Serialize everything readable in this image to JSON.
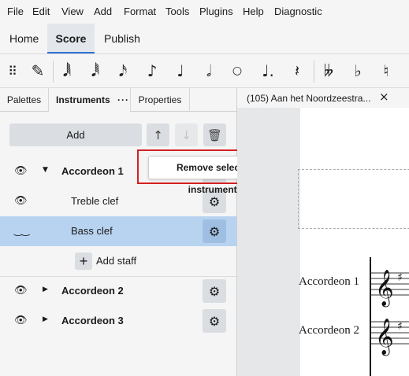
{
  "menu": [
    "File",
    "Edit",
    "View",
    "Add",
    "Format",
    "Tools",
    "Plugins",
    "Help",
    "Diagnostic"
  ],
  "workspace_tabs": [
    {
      "label": "Home",
      "active": false
    },
    {
      "label": "Score",
      "active": true
    },
    {
      "label": "Publish",
      "active": false
    }
  ],
  "toolbar": {
    "icons": [
      "drag-handle-icon",
      "pencil-icon",
      "64th-note-icon",
      "32nd-note-icon",
      "16th-note-icon",
      "eighth-note-icon",
      "quarter-note-icon",
      "half-note-icon",
      "whole-note-icon",
      "augmentation-dot-icon",
      "quarter-rest-icon",
      "double-flat-icon",
      "flat-icon",
      "natural-icon"
    ]
  },
  "panel": {
    "tabs": [
      {
        "label": "Palettes"
      },
      {
        "label": "Instruments",
        "menu": "···",
        "active": true
      },
      {
        "label": "Properties"
      }
    ],
    "add_label": "Add",
    "tooltip": "Remove selected instruments",
    "rows": [
      {
        "label": "Accordeon 1",
        "bold": true,
        "expanded": true
      },
      {
        "label": "Treble clef",
        "bold": false
      },
      {
        "label": "Bass clef",
        "bold": false,
        "selected": true
      },
      {
        "label": "Add staff"
      },
      {
        "label": "Accordeon 2",
        "bold": true,
        "expanded": false
      },
      {
        "label": "Accordeon 3",
        "bold": true,
        "expanded": false
      }
    ]
  },
  "document": {
    "tab_title": "(105) Aan het Noordzeestra...",
    "staff_names": [
      "Accordeon 1",
      "Accordeon 2"
    ]
  }
}
